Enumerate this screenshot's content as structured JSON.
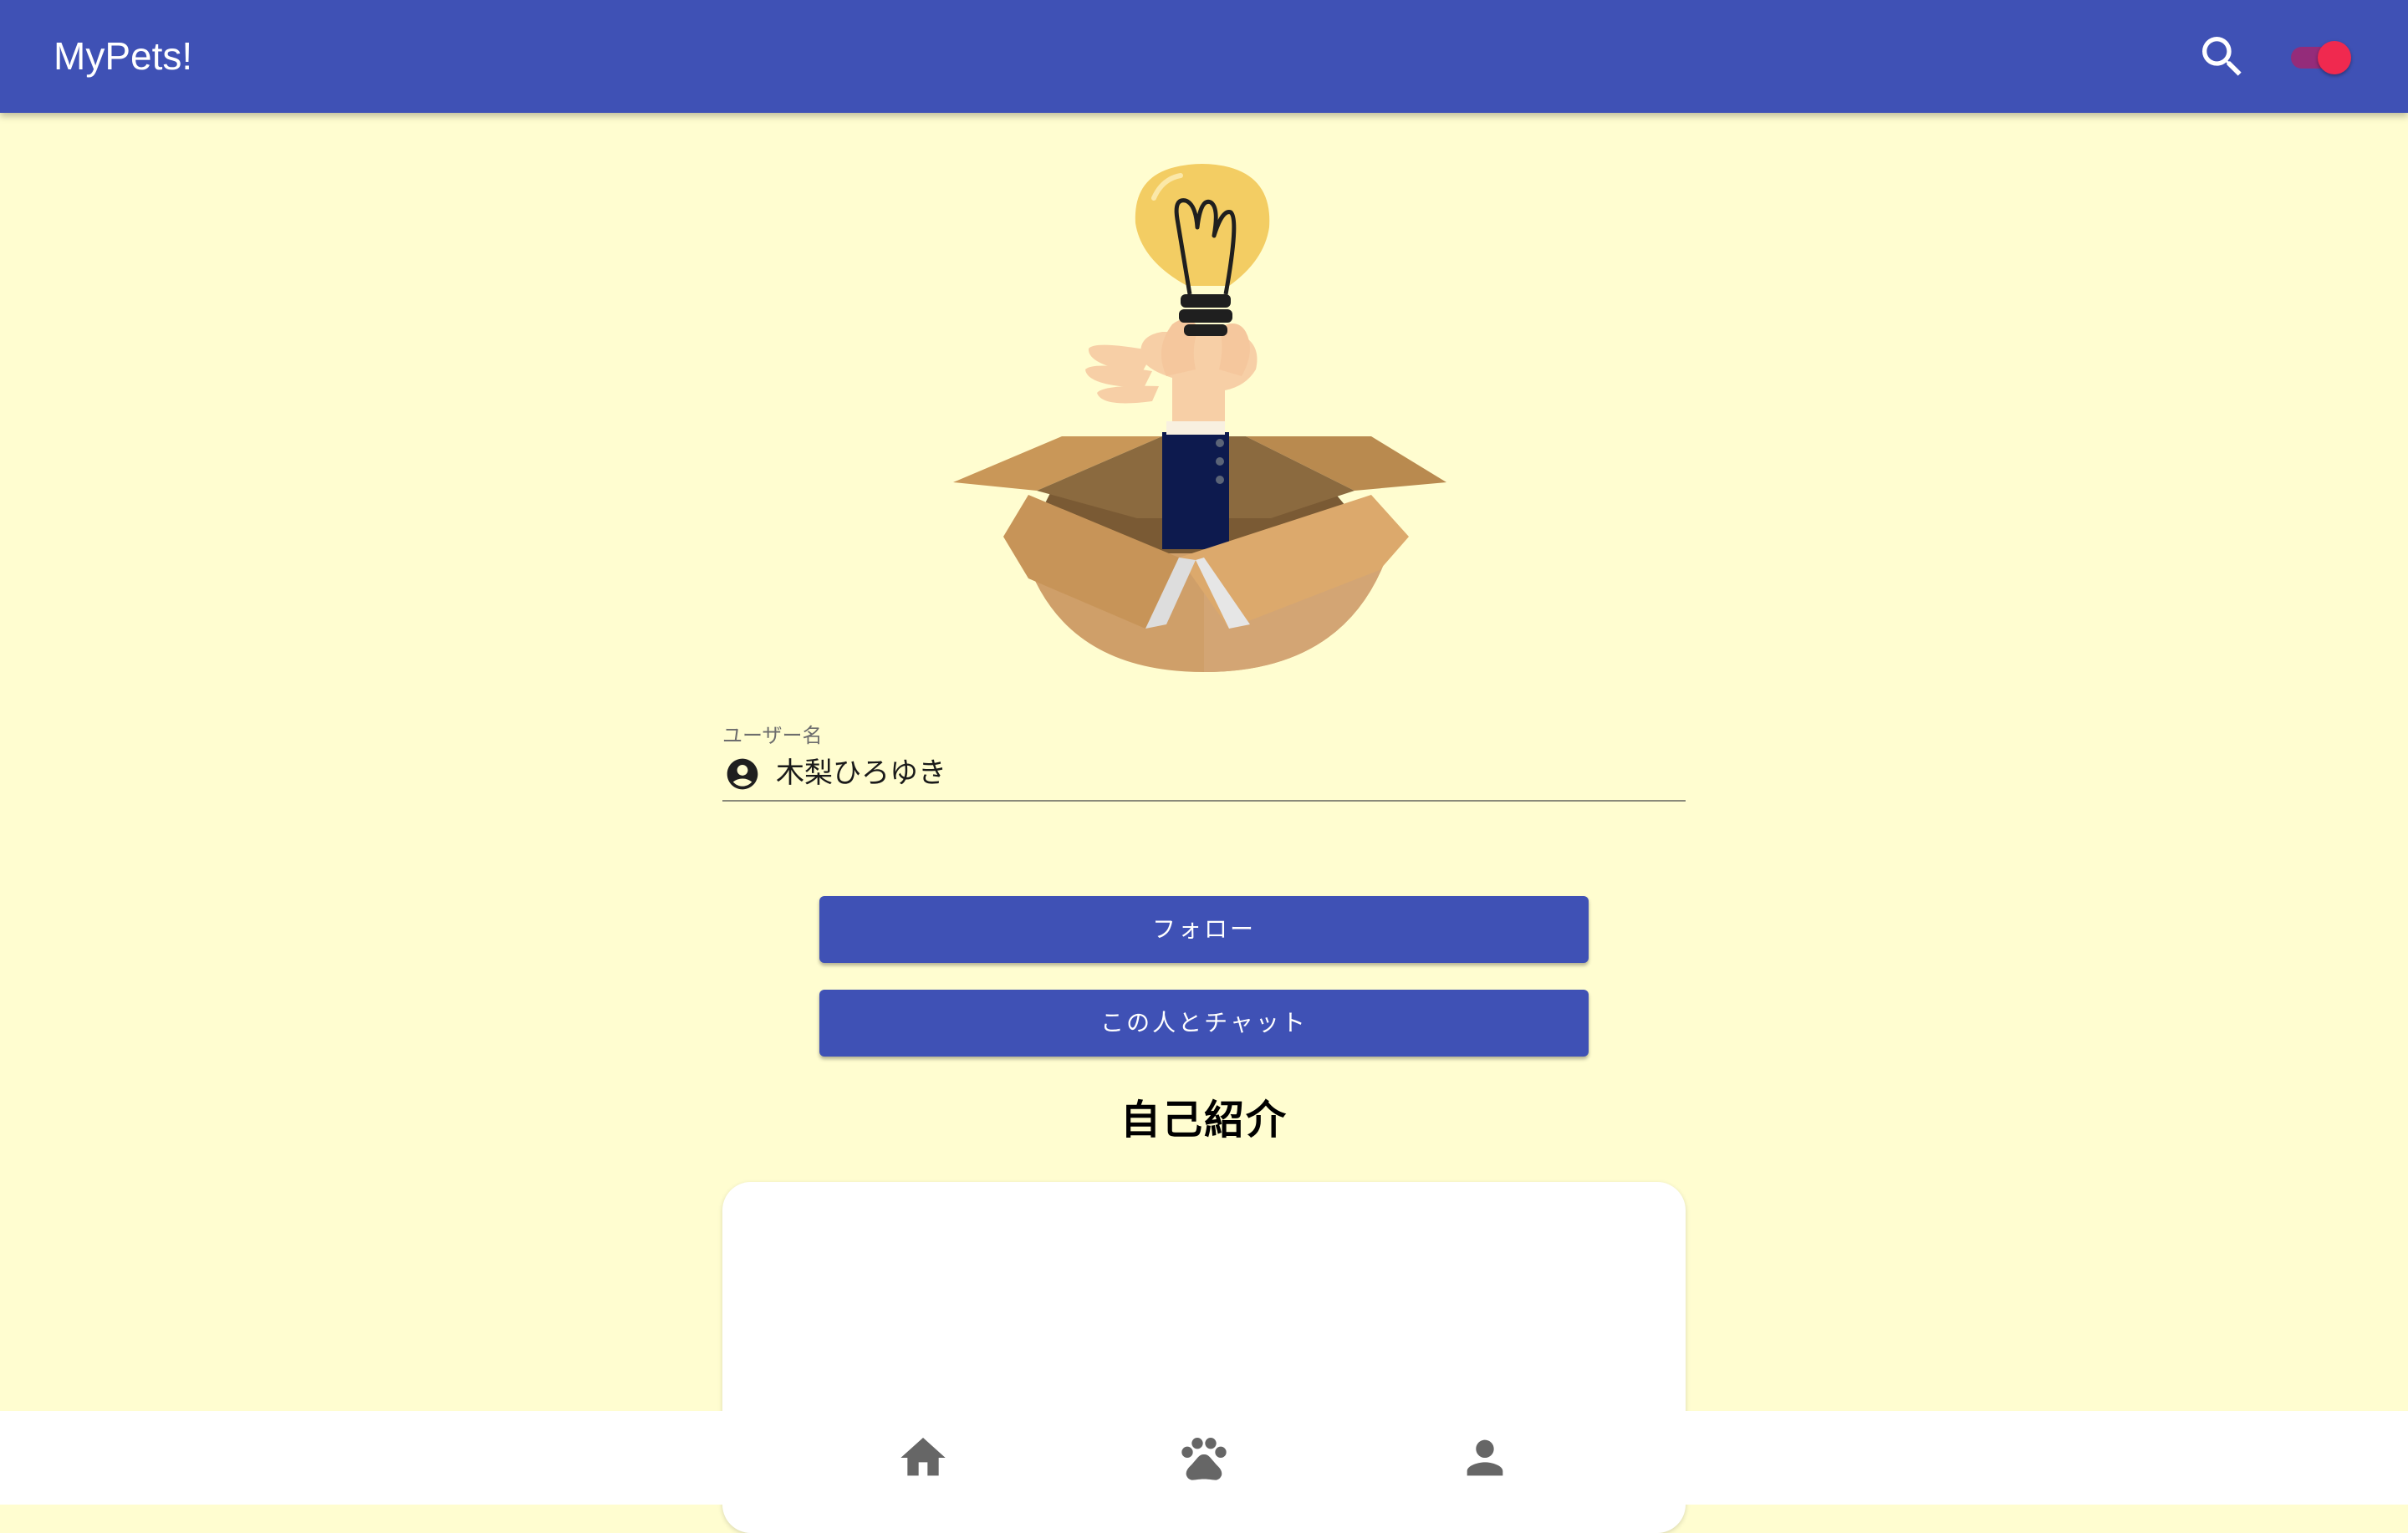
{
  "app": {
    "title": "MyPets!",
    "header_color": "#3f51b5",
    "background_color": "#fffdd0"
  },
  "toolbar": {
    "search_icon": "search-icon",
    "theme_toggle": {
      "state": "on",
      "color": "#f0294f"
    }
  },
  "profile": {
    "username_label": "ユーザー名",
    "username_value": "木梨ひろゆき",
    "username_icon": "account-circle-icon",
    "illustration": "lightbulb-hand-box-illustration"
  },
  "actions": {
    "follow_label": "フォロー",
    "chat_label": "この人とチャット"
  },
  "bio": {
    "heading": "自己紹介",
    "text": ""
  },
  "bottom_nav": {
    "items": [
      {
        "icon": "home-icon"
      },
      {
        "icon": "paw-icon"
      },
      {
        "icon": "person-icon"
      }
    ]
  }
}
